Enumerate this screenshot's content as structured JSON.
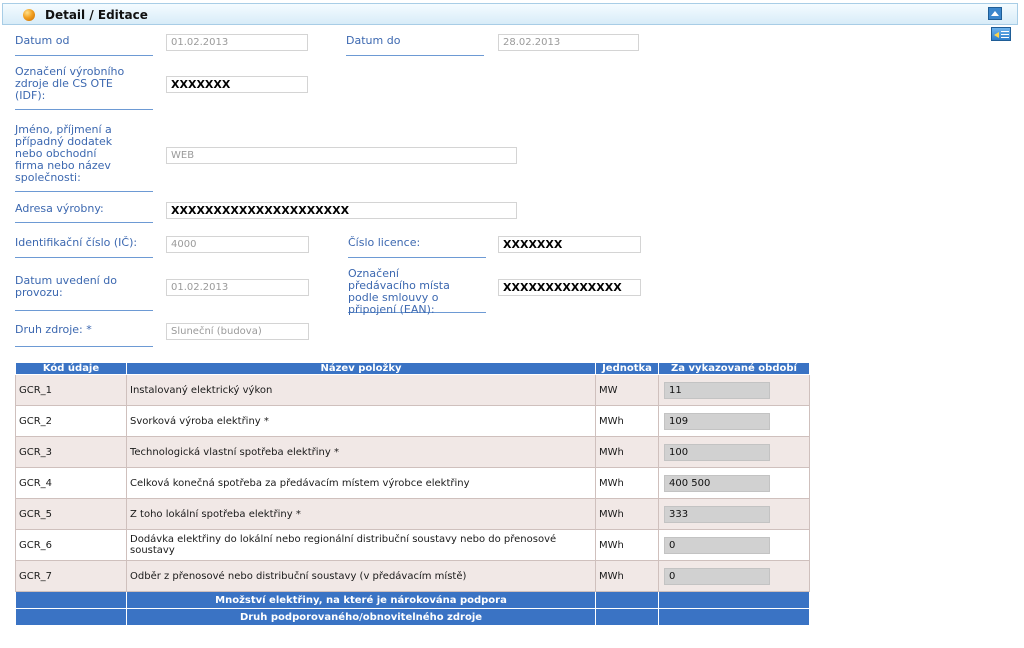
{
  "header": {
    "title": "Detail / Editace"
  },
  "form": {
    "datum_od": {
      "label": "Datum od",
      "value": "01.02.2013"
    },
    "datum_do": {
      "label": "Datum do",
      "value": "28.02.2013"
    },
    "idf": {
      "label": "Označení výrobního zdroje dle CS OTE (IDF):",
      "value": "XXXXXXX"
    },
    "jmeno": {
      "label": "Jméno, příjmení a případný dodatek nebo obchodní firma nebo název společnosti:",
      "value": "WEB"
    },
    "adresa": {
      "label": "Adresa výrobny:",
      "value": "XXXXXXXXXXXXXXXXXXXXX"
    },
    "ic": {
      "label": "Identifikační číslo (IČ):",
      "value": "4000"
    },
    "licence": {
      "label": "Číslo licence:",
      "value": "XXXXXXX"
    },
    "datum_uvedeni": {
      "label": "Datum uvedení do provozu:",
      "value": "01.02.2013"
    },
    "ean": {
      "label": "Označení předávacího místa podle smlouvy o připojení (EAN):",
      "value": "XXXXXXXXXXXXXX"
    },
    "druh": {
      "label": "Druh zdroje: *",
      "value": "Sluneční (budova)"
    }
  },
  "table": {
    "headers": [
      "Kód údaje",
      "Název položky",
      "Jednotka",
      "Za vykazované období"
    ],
    "rows": [
      {
        "code": "GCR_1",
        "name": "Instalovaný elektrický výkon",
        "unit": "MW",
        "value": "11"
      },
      {
        "code": "GCR_2",
        "name": "Svorková výroba elektřiny *",
        "unit": "MWh",
        "value": "109"
      },
      {
        "code": "GCR_3",
        "name": "Technologická vlastní spotřeba elektřiny *",
        "unit": "MWh",
        "value": "100"
      },
      {
        "code": "GCR_4",
        "name": "Celková konečná spotřeba za předávacím místem výrobce elektřiny",
        "unit": "MWh",
        "value": "400 500"
      },
      {
        "code": "GCR_5",
        "name": "Z toho lokální spotřeba elektřiny *",
        "unit": "MWh",
        "value": "333"
      },
      {
        "code": "GCR_6",
        "name": "Dodávka elektřiny do lokální nebo regionální distribuční soustavy nebo do přenosové soustavy",
        "unit": "MWh",
        "value": "0"
      },
      {
        "code": "GCR_7",
        "name": "Odběr z přenosové nebo distribuční soustavy (v předávacím místě)",
        "unit": "MWh",
        "value": "0"
      }
    ],
    "section1": "Množství elektřiny, na které je nárokována podpora",
    "section2": "Druh podporovaného/obnovitelného zdroje"
  }
}
